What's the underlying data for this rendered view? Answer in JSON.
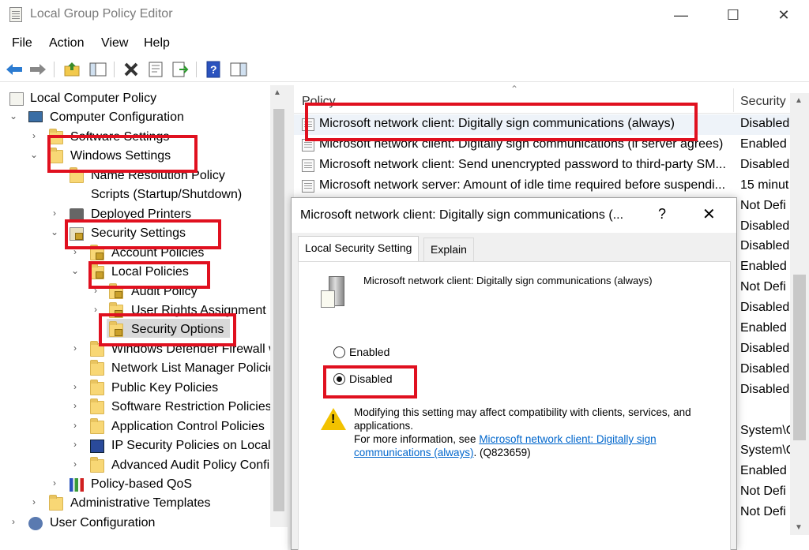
{
  "window": {
    "title": "Local Group Policy Editor",
    "minimize": "—",
    "maximize": "☐",
    "close": "✕"
  },
  "menu": [
    "File",
    "Action",
    "View",
    "Help"
  ],
  "toolbar_icons": [
    "back-arrow-icon",
    "forward-arrow-icon",
    "up-folder-icon",
    "show-hide-tree-icon",
    "delete-icon",
    "properties-icon",
    "export-list-icon",
    "help-icon",
    "show-pane-icon"
  ],
  "tree": [
    {
      "label": "Local Computer Policy",
      "indent": 0,
      "chevron": "",
      "icon": "policy-doc-icon"
    },
    {
      "label": "Computer Configuration",
      "indent": 1,
      "chevron": "⌄",
      "icon": "computer-icon"
    },
    {
      "label": "Software Settings",
      "indent": 2,
      "chevron": "›",
      "icon": "folder-icon"
    },
    {
      "label": "Windows Settings",
      "indent": 2,
      "chevron": "⌄",
      "icon": "folder-icon"
    },
    {
      "label": "Name Resolution Policy",
      "indent": 3,
      "chevron": "",
      "icon": "folder-icon"
    },
    {
      "label": "Scripts (Startup/Shutdown)",
      "indent": 3,
      "chevron": "",
      "icon": "script-icon"
    },
    {
      "label": "Deployed Printers",
      "indent": 3,
      "chevron": "›",
      "icon": "printer-icon"
    },
    {
      "label": "Security Settings",
      "indent": 3,
      "chevron": "⌄",
      "icon": "security-settings-icon"
    },
    {
      "label": "Account Policies",
      "indent": 4,
      "chevron": "›",
      "icon": "lock-folder-icon"
    },
    {
      "label": "Local Policies",
      "indent": 4,
      "chevron": "⌄",
      "icon": "lock-folder-icon"
    },
    {
      "label": "Audit Policy",
      "indent": 5,
      "chevron": "›",
      "icon": "lock-folder-icon"
    },
    {
      "label": "User Rights Assignment",
      "indent": 5,
      "chevron": "›",
      "icon": "lock-folder-icon"
    },
    {
      "label": "Security Options",
      "indent": 5,
      "chevron": "",
      "icon": "lock-folder-icon"
    },
    {
      "label": "Windows Defender Firewall w",
      "indent": 4,
      "chevron": "›",
      "icon": "folder-icon"
    },
    {
      "label": "Network List Manager Policie",
      "indent": 4,
      "chevron": "",
      "icon": "folder-icon"
    },
    {
      "label": "Public Key Policies",
      "indent": 4,
      "chevron": "›",
      "icon": "folder-icon"
    },
    {
      "label": "Software Restriction Policies",
      "indent": 4,
      "chevron": "›",
      "icon": "folder-icon"
    },
    {
      "label": "Application Control Policies",
      "indent": 4,
      "chevron": "›",
      "icon": "folder-icon"
    },
    {
      "label": "IP Security Policies on Local C",
      "indent": 4,
      "chevron": "›",
      "icon": "ip-security-icon"
    },
    {
      "label": "Advanced Audit Policy Confi",
      "indent": 4,
      "chevron": "›",
      "icon": "folder-icon"
    },
    {
      "label": "Policy-based QoS",
      "indent": 3,
      "chevron": "›",
      "icon": "chart-icon"
    },
    {
      "label": "Administrative Templates",
      "indent": 2,
      "chevron": "›",
      "icon": "folder-icon"
    },
    {
      "label": "User Configuration",
      "indent": 1,
      "chevron": "›",
      "icon": "user-icon"
    }
  ],
  "list": {
    "col_policy": "Policy",
    "col_security": "Security",
    "rows": [
      {
        "policy": "Microsoft network client: Digitally sign communications (always)",
        "security": "Disabled"
      },
      {
        "policy": "Microsoft network client: Digitally sign communications (if server agrees)",
        "security": "Enabled"
      },
      {
        "policy": "Microsoft network client: Send unencrypted password to third-party SM...",
        "security": "Disabled"
      },
      {
        "policy": "Microsoft network server: Amount of idle time required before suspendi...",
        "security": "15 minut"
      },
      {
        "policy": "",
        "security": "Not Defi"
      },
      {
        "policy": "",
        "security": "Disabled"
      },
      {
        "policy": "",
        "security": "Disabled"
      },
      {
        "policy": "",
        "security": "Enabled"
      },
      {
        "policy": "",
        "security": "Not Defi"
      },
      {
        "policy": "",
        "security": "Disabled"
      },
      {
        "policy": "",
        "security": "Enabled"
      },
      {
        "policy": "",
        "security": "Disabled"
      },
      {
        "policy": "",
        "security": "Disabled"
      },
      {
        "policy": "",
        "security": "Disabled"
      },
      {
        "policy": "",
        "security": ""
      },
      {
        "policy": "",
        "security": "System\\C"
      },
      {
        "policy": "",
        "security": "System\\C"
      },
      {
        "policy": "",
        "security": "Enabled"
      },
      {
        "policy": "",
        "security": "Not Defi"
      },
      {
        "policy": "",
        "security": "Not Defi"
      }
    ]
  },
  "dialog": {
    "title": "Microsoft network client: Digitally sign communications (...",
    "help": "?",
    "close": "✕",
    "tabs": [
      "Local Security Setting",
      "Explain"
    ],
    "policy_name": "Microsoft network client: Digitally sign communications (always)",
    "option_enabled": "Enabled",
    "option_disabled": "Disabled",
    "selected": "Disabled",
    "warning_line1": "Modifying this setting may affect compatibility with clients, services, and applications.",
    "warning_more_prefix": "For more information, see ",
    "warning_link": "Microsoft network client: Digitally sign communications (always)",
    "warning_suffix": ". (Q823659)"
  },
  "colors": {
    "annotation": "#e0101f",
    "link": "#0066cc",
    "folder": "#f8d775"
  }
}
